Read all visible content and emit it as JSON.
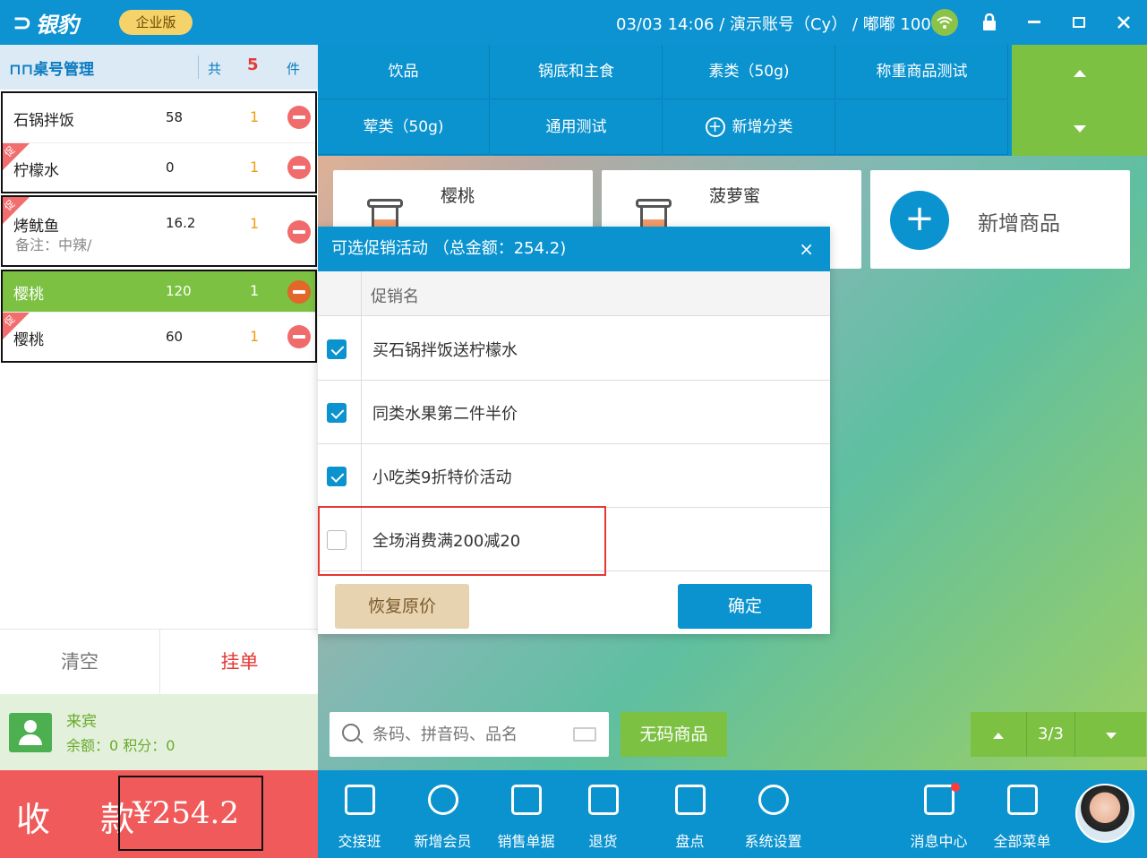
{
  "titlebar": {
    "logo": "银豹",
    "edition": "企业版",
    "status": "03/03 14:06 / 演示账号（Cy） / 嘟嘟 1001",
    "colors": {
      "bar": "#0d93d1",
      "wifi": "#8bc34a"
    }
  },
  "cart": {
    "title": "桌号管理",
    "total_prefix": "共",
    "total_count": "5",
    "total_suffix": "件",
    "items": [
      {
        "name": "石锅拌饭",
        "price": "58",
        "qty": "1",
        "tag": ""
      },
      {
        "name": "柠檬水",
        "price": "0",
        "qty": "1",
        "tag": "促"
      },
      {
        "name": "烤鱿鱼",
        "price": "16.2",
        "qty": "1",
        "tag": "促",
        "note": "备注：中辣/"
      },
      {
        "name": "樱桃",
        "price": "120",
        "qty": "1",
        "tag": ""
      },
      {
        "name": "樱桃",
        "price": "60",
        "qty": "1",
        "tag": "促"
      }
    ],
    "clear_label": "清空",
    "hold_label": "挂单"
  },
  "member": {
    "name": "来宾",
    "balance": "余额：0 积分：0"
  },
  "pay": {
    "label": "收 款",
    "amount": "¥254.2"
  },
  "categories": [
    {
      "label": "饮品"
    },
    {
      "label": "锅底和主食"
    },
    {
      "label": "素类（50g)"
    },
    {
      "label": "称重商品测试"
    },
    {
      "label": "荤类（50g)"
    },
    {
      "label": "通用测试"
    },
    {
      "label": "新增分类"
    }
  ],
  "products": [
    {
      "name": "樱桃"
    },
    {
      "name": "菠萝蜜"
    }
  ],
  "add_product": {
    "label": "新增商品"
  },
  "search": {
    "placeholder": "条码、拼音码、品名"
  },
  "nocode_label": "无码商品",
  "pager": {
    "page": "3/3"
  },
  "toolbar": [
    {
      "label": "交接班",
      "icon": "shift-handover-icon"
    },
    {
      "label": "新增会员",
      "icon": "add-member-icon"
    },
    {
      "label": "销售单据",
      "icon": "sales-doc-icon"
    },
    {
      "label": "退货",
      "icon": "return-icon"
    },
    {
      "label": "盘点",
      "icon": "inventory-icon"
    },
    {
      "label": "系统设置",
      "icon": "settings-icon"
    },
    {
      "label": "消息中心",
      "icon": "message-icon"
    },
    {
      "label": "全部菜单",
      "icon": "all-menu-icon"
    }
  ],
  "modal": {
    "title": "可选促销活动 （总金额：254.2)",
    "close": "×",
    "column": "促销名",
    "promotions": [
      {
        "name": "买石锅拌饭送柠檬水",
        "checked": true
      },
      {
        "name": "同类水果第二件半价",
        "checked": true
      },
      {
        "name": "小吃类9折特价活动",
        "checked": true
      },
      {
        "name": "全场消费满200减20",
        "checked": false
      }
    ],
    "restore_label": "恢复原价",
    "ok_label": "确定"
  }
}
